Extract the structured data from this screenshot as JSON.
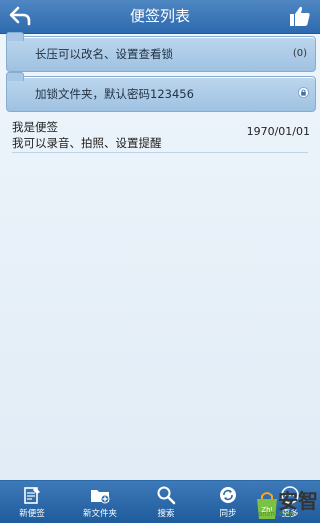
{
  "header": {
    "title": "便签列表"
  },
  "folders": [
    {
      "label": "长压可以改名、设置查看锁",
      "count": "(0)",
      "locked": false
    },
    {
      "label": "加锁文件夹，默认密码123456",
      "count": "",
      "locked": true
    }
  ],
  "notes": [
    {
      "line1": "我是便签",
      "line2": "我可以录音、拍照、设置提醒",
      "date": "1970/01/01"
    }
  ],
  "toolbar": {
    "new_note": "新便签",
    "new_folder": "新文件夹",
    "search": "搜索",
    "sync": "同步",
    "more": "更多"
  },
  "watermark": {
    "text": "安智",
    "sub": "anzhi.com"
  }
}
